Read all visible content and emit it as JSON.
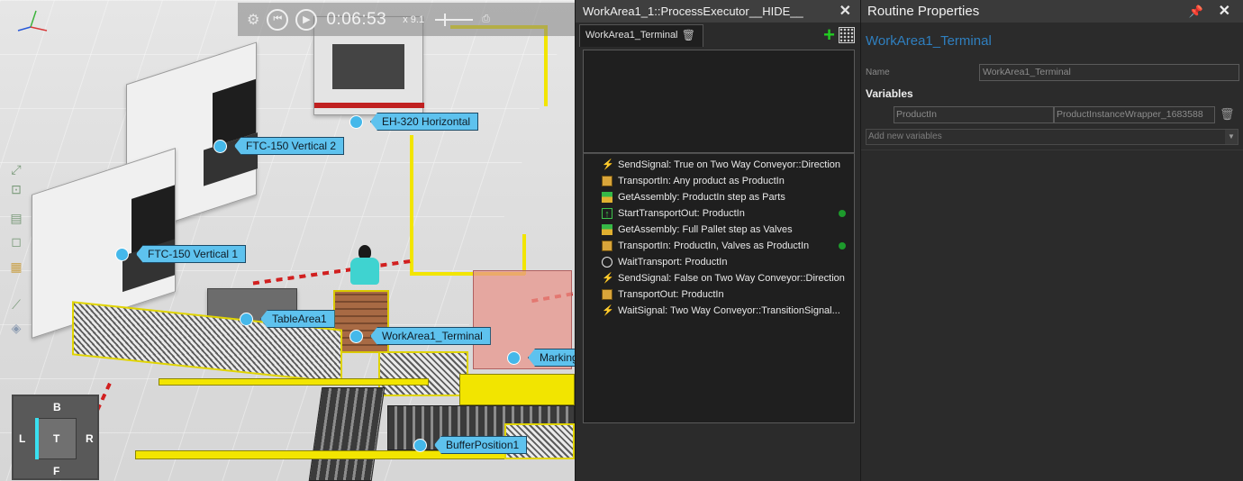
{
  "viewport": {
    "sim_time": "0:06:53",
    "speed": "x 9.1",
    "nav_cube": {
      "top": "B",
      "left": "L",
      "center": "T",
      "right": "R",
      "bottom": "F"
    },
    "tags": [
      {
        "label": "FTC-150 Vertical 2"
      },
      {
        "label": "EH-320 Horizontal"
      },
      {
        "label": "FTC-150 Vertical 1"
      },
      {
        "label": "TableArea1"
      },
      {
        "label": "WorkArea1_Terminal"
      },
      {
        "label": "Marking"
      },
      {
        "label": "BufferPosition1"
      }
    ]
  },
  "process_panel": {
    "title": "WorkArea1_1::ProcessExecutor__HIDE__",
    "tab_label": "WorkArea1_Terminal",
    "statements": [
      {
        "text": "SendSignal: True on Two Way Conveyor::Direction",
        "icon": "signal-icon",
        "running": false
      },
      {
        "text": "TransportIn: Any product as ProductIn",
        "icon": "transport-in-icon",
        "running": false
      },
      {
        "text": "GetAssembly: ProductIn step as Parts",
        "icon": "assembly-icon",
        "running": false
      },
      {
        "text": "StartTransportOut: ProductIn",
        "icon": "start-transport-out-icon",
        "running": true
      },
      {
        "text": "GetAssembly: Full Pallet step as Valves",
        "icon": "assembly-icon",
        "running": false
      },
      {
        "text": "TransportIn: ProductIn, Valves as ProductIn",
        "icon": "transport-in-icon",
        "running": true
      },
      {
        "text": "WaitTransport: ProductIn",
        "icon": "wait-icon",
        "running": false
      },
      {
        "text": "SendSignal: False on Two Way Conveyor::Direction",
        "icon": "signal-icon",
        "running": false
      },
      {
        "text": "TransportOut: ProductIn",
        "icon": "transport-out-icon",
        "running": false
      },
      {
        "text": "WaitSignal: Two Way Conveyor::TransitionSignal...",
        "icon": "signal-icon",
        "running": false
      }
    ]
  },
  "properties_panel": {
    "title": "Routine Properties",
    "routine_name": "WorkArea1_Terminal",
    "name_label": "Name",
    "name_value": "WorkArea1_Terminal",
    "variables_label": "Variables",
    "variable": {
      "name": "ProductIn",
      "type": "ProductInstanceWrapper_1683588"
    },
    "add_variable_placeholder": "Add new variables"
  },
  "colors": {
    "tag_fill": "#5ec2ee",
    "accent_blue": "#2f7fbf",
    "running_green": "#1d9a2c",
    "add_green": "#22cc22",
    "safety_yellow": "#f2e500"
  }
}
